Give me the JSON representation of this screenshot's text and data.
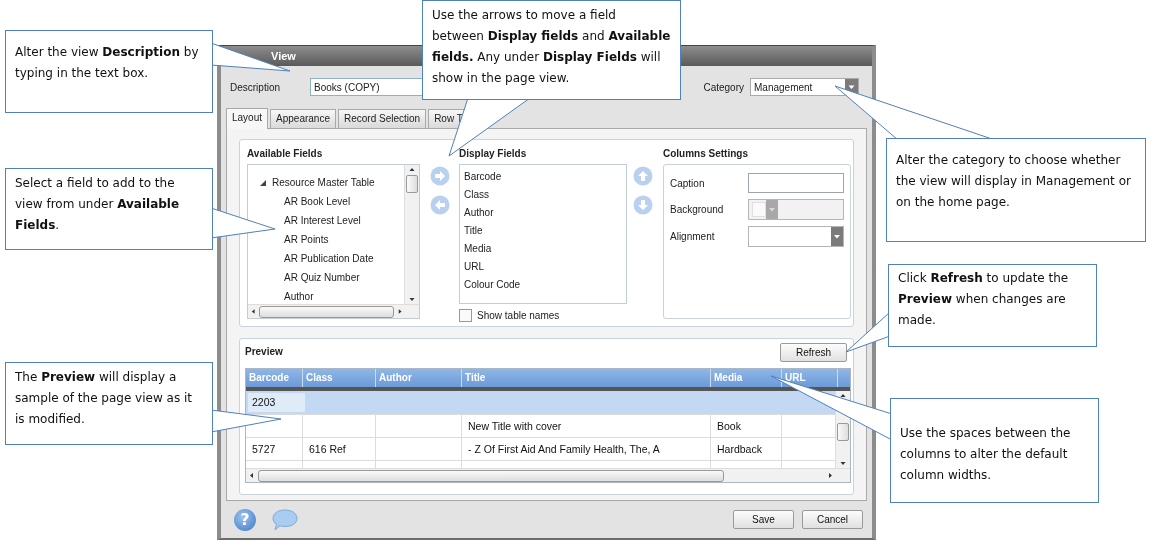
{
  "dialog": {
    "title": "View",
    "description": {
      "label": "Description",
      "value": "Books (COPY)"
    },
    "category": {
      "label": "Category",
      "value": "Management"
    },
    "tabs": [
      {
        "label": "Layout",
        "selected": true
      },
      {
        "label": "Appearance",
        "selected": false
      },
      {
        "label": "Record Selection",
        "selected": false
      },
      {
        "label": "Row T",
        "selected": false
      }
    ],
    "available_fields": {
      "heading": "Available Fields",
      "tree": [
        {
          "label": "Resource Master Table",
          "expanded": true,
          "children": [
            {
              "label": "AR Book Level"
            },
            {
              "label": "AR Interest Level"
            },
            {
              "label": "AR Points"
            },
            {
              "label": "AR Publication Date"
            },
            {
              "label": "AR Quiz Number"
            },
            {
              "label": "Author"
            }
          ]
        }
      ]
    },
    "display_fields": {
      "heading": "Display Fields",
      "items": [
        "Barcode",
        "Class",
        "Author",
        "Title",
        "Media",
        "URL",
        "Colour Code"
      ],
      "show_table_names": {
        "label": "Show table names",
        "checked": false
      }
    },
    "columns_settings": {
      "heading": "Columns Settings",
      "fields": [
        {
          "label": "Caption",
          "kind": "text",
          "disabled": false
        },
        {
          "label": "Background",
          "kind": "color",
          "disabled": true
        },
        {
          "label": "Alignment",
          "kind": "select",
          "disabled": false
        }
      ]
    },
    "preview": {
      "heading": "Preview",
      "refresh": "Refresh",
      "columns": [
        "Barcode",
        "Class",
        "Author",
        "Title",
        "Media",
        "URL"
      ],
      "rows": [
        {
          "selected": true,
          "barcode": "2203"
        },
        {
          "selected": false,
          "title": "New Title with cover",
          "media": "Book"
        },
        {
          "selected": false,
          "barcode": "5727",
          "class": "616 Ref",
          "title": "- Z Of First Aid And Family Health, The, A",
          "media": "Hardback"
        }
      ]
    },
    "help_glyph": "?",
    "buttons": [
      "Save",
      "Cancel"
    ]
  },
  "callouts": [
    {
      "text": "Alter the view **Description** by typing in the text box."
    },
    {
      "text": "Use the arrows to move a field between **Display fields** and **Available fields.** Any under **Display Fields** will show in the page view."
    },
    {
      "text": "Alter the category to choose whether the view will display in Management or on the home page."
    },
    {
      "text": "Select a field to add to the view from under **Available Fields**."
    },
    {
      "text": "Click **Refresh** to update the **Preview** when changes are made."
    },
    {
      "text": "The **Preview** will display a sample of the page view as it is modified."
    },
    {
      "text": "Use the spaces between the columns to alter the default column widths."
    }
  ]
}
